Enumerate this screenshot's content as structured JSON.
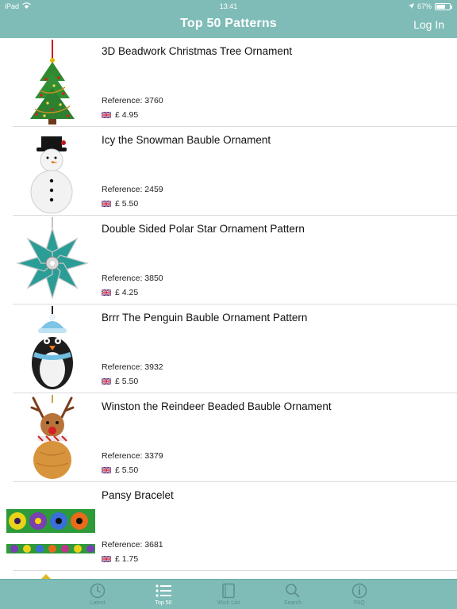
{
  "status": {
    "device": "iPad",
    "time": "13:41",
    "battery": "67%",
    "battery_level": 0.67
  },
  "nav": {
    "title": "Top 50 Patterns",
    "login_label": "Log In"
  },
  "items": [
    {
      "title": "3D Beadwork Christmas Tree Ornament",
      "reference": "Reference: 3760",
      "price": "£ 4.95",
      "thumb": "christmas-tree"
    },
    {
      "title": "Icy the Snowman Bauble Ornament",
      "reference": "Reference: 2459",
      "price": "£ 5.50",
      "thumb": "snowman"
    },
    {
      "title": "Double Sided Polar Star Ornament Pattern",
      "reference": "Reference: 3850",
      "price": "£ 4.25",
      "thumb": "polar-star"
    },
    {
      "title": "Brrr The Penguin Bauble Ornament Pattern",
      "reference": "Reference: 3932",
      "price": "£ 5.50",
      "thumb": "penguin"
    },
    {
      "title": "Winston the Reindeer Beaded Bauble Ornament",
      "reference": "Reference: 3379",
      "price": "£ 5.50",
      "thumb": "reindeer"
    },
    {
      "title": "Pansy Bracelet",
      "reference": "Reference: 3681",
      "price": "£ 1.75",
      "thumb": "pansy-bracelet"
    }
  ],
  "tabs": [
    {
      "label": "Latest",
      "icon": "clock-icon",
      "active": false
    },
    {
      "label": "Top 50",
      "icon": "list-icon",
      "active": true
    },
    {
      "label": "Wish List",
      "icon": "book-icon",
      "active": false
    },
    {
      "label": "Search",
      "icon": "search-icon",
      "active": false
    },
    {
      "label": "FAQ",
      "icon": "info-icon",
      "active": false
    }
  ],
  "colors": {
    "bar": "#7fbcb7",
    "tab_inactive": "#5c8f8b",
    "tab_active": "#ffffff",
    "separator": "#dcdcdc"
  }
}
